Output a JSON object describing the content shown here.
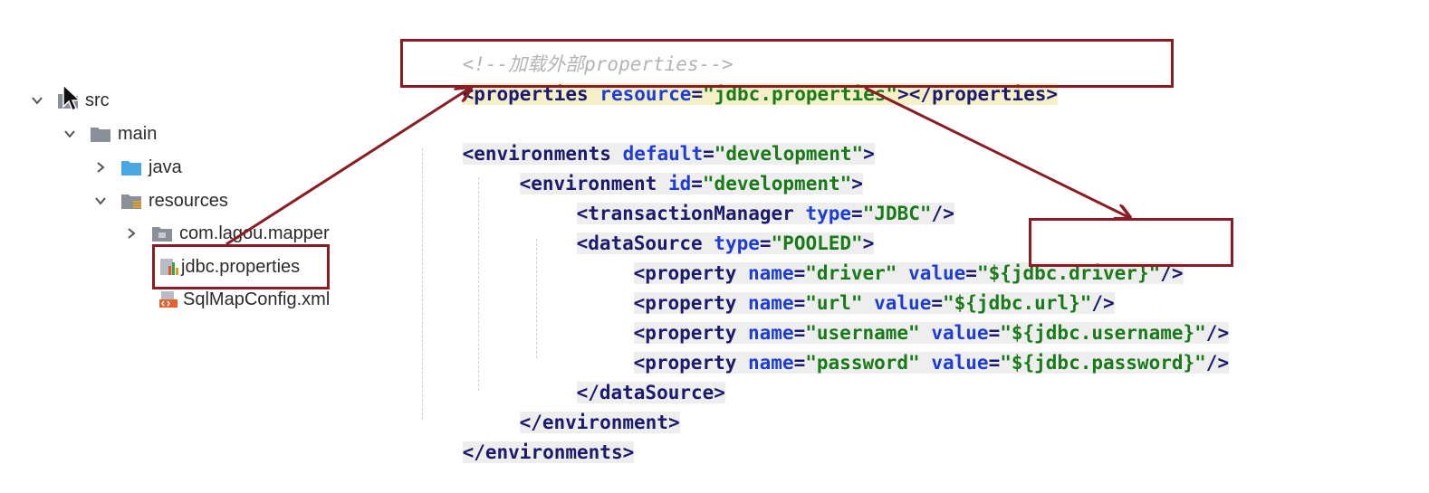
{
  "tree": {
    "items": [
      {
        "label": "src",
        "icon": "source-folder-icon",
        "expanded": true
      },
      {
        "label": "main",
        "icon": "folder-icon",
        "expanded": true
      },
      {
        "label": "java",
        "icon": "java-source-folder-icon",
        "expanded": false
      },
      {
        "label": "resources",
        "icon": "resources-folder-icon",
        "expanded": true
      },
      {
        "label": "com.lagou.mapper",
        "icon": "package-folder-icon",
        "expanded": false
      },
      {
        "label": "jdbc.properties",
        "icon": "properties-file-icon"
      },
      {
        "label": "SqlMapConfig.xml",
        "icon": "xml-file-icon"
      }
    ]
  },
  "code": {
    "comment": "<!--加载外部properties-->",
    "properties_open": "<properties ",
    "properties_attr": "resource",
    "properties_val": "\"jdbc.properties\"",
    "properties_close": "></properties>",
    "envs_open": "<environments ",
    "envs_attr": "default",
    "envs_val": "\"development\"",
    "envs_gt": ">",
    "env_open": "<environment ",
    "env_attr": "id",
    "env_val": "\"development\"",
    "env_gt": ">",
    "tm_open": "<transactionManager ",
    "tm_attr": "type",
    "tm_val": "\"JDBC\"",
    "tm_close": "/>",
    "ds_open": "<dataSource ",
    "ds_attr": "type",
    "ds_val": "\"POOLED\"",
    "ds_gt": ">",
    "property_open": "<property ",
    "name_attr": "name",
    "value_attr": "value",
    "self_close": "/>",
    "properties": [
      {
        "name": "\"driver\"",
        "value": "\"${jdbc.driver}\""
      },
      {
        "name": "\"url\"",
        "value": "\"${jdbc.url}\""
      },
      {
        "name": "\"username\"",
        "value": "\"${jdbc.username}\""
      },
      {
        "name": "\"password\"",
        "value": "\"${jdbc.password}\""
      }
    ],
    "ds_end": "</dataSource>",
    "env_end": "</environment>",
    "envs_end": "</environments>",
    "eq": "="
  },
  "annotation": {
    "color": "#8b1c24"
  }
}
